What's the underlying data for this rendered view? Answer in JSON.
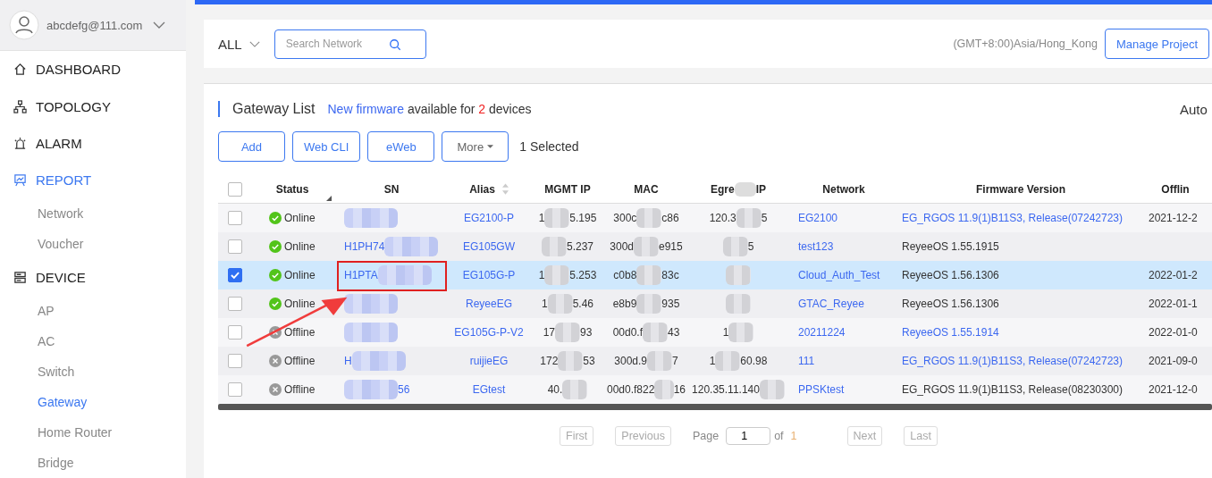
{
  "sidebar": {
    "user": "abcdefg@111.com",
    "items": [
      {
        "label": "DASHBOARD",
        "selected": false
      },
      {
        "label": "TOPOLOGY",
        "selected": false
      },
      {
        "label": "ALARM",
        "selected": false
      },
      {
        "label": "REPORT",
        "selected": true,
        "children": [
          {
            "label": "Network",
            "selected": false
          },
          {
            "label": "Voucher",
            "selected": false
          }
        ]
      },
      {
        "label": "DEVICE",
        "selected": false,
        "children": [
          {
            "label": "AP",
            "selected": false
          },
          {
            "label": "AC",
            "selected": false
          },
          {
            "label": "Switch",
            "selected": false
          },
          {
            "label": "Gateway",
            "selected": true
          },
          {
            "label": "Home Router",
            "selected": false
          },
          {
            "label": "Bridge",
            "selected": false
          }
        ]
      }
    ]
  },
  "header": {
    "scope": "ALL",
    "search": {
      "placeholder": "Search Network"
    },
    "timezone": "(GMT+8:00)Asia/Hong_Kong",
    "manage_button": "Manage Project"
  },
  "list": {
    "title": "Gateway List",
    "notice": {
      "link": "New firmware",
      "text1": "available for",
      "count": "2",
      "text2": "devices"
    },
    "auto": "Auto",
    "buttons": [
      "Add",
      "Web CLI",
      "eWeb"
    ],
    "more": "More",
    "selected_count": "1 Selected",
    "select_all": {
      "checked": false
    },
    "columns": [
      {
        "label": "Status"
      },
      {
        "label": "SN"
      },
      {
        "label": "Alias"
      },
      {
        "label": "MGMT IP"
      },
      {
        "label": "MAC"
      },
      {
        "pre": "Egre",
        "post": "IP"
      },
      {
        "label": "Network"
      },
      {
        "label": "Firmware Version"
      },
      {
        "label": "Offlin"
      }
    ],
    "rows": [
      {
        "checked": false,
        "kind": "online",
        "status": "Online",
        "sn": {},
        "alias": "EG2100-P",
        "mgmt": {
          "pre": "1",
          "post": "5.195"
        },
        "mac": {
          "pre": "300c",
          "post": "c86"
        },
        "egress": {
          "pre": "120.3",
          "post": "5"
        },
        "network": "EG2100",
        "firmware": {
          "text": "EG_RGOS 11.9(1)B11S3, Release(07242723)",
          "link": true
        },
        "offline": "2021-12-2"
      },
      {
        "checked": false,
        "kind": "online",
        "status": "Online",
        "sn": {
          "pre": "H1PH74"
        },
        "alias": "EG105GW",
        "mgmt": {
          "post": "5.237"
        },
        "mac": {
          "pre": "300d",
          "post": "e915"
        },
        "egress": {
          "post": "5"
        },
        "network": "test123",
        "firmware": {
          "text": "ReyeeOS 1.55.1915",
          "link": false
        }
      },
      {
        "checked": true,
        "kind": "online",
        "status": "Online",
        "sn": {
          "pre": "H1PTA"
        },
        "alias": "EG105G-P",
        "mgmt": {
          "pre": "1",
          "post": "5.253"
        },
        "mac": {
          "pre": "c0b8",
          "post": "83c"
        },
        "egress": {},
        "network": "Cloud_Auth_Test",
        "firmware": {
          "text": "ReyeeOS 1.56.1306",
          "link": false
        },
        "offline": "2022-01-2"
      },
      {
        "checked": false,
        "kind": "online",
        "status": "Online",
        "sn": {},
        "alias": "ReyeeEG",
        "mgmt": {
          "pre": "1",
          "post": "5.46"
        },
        "mac": {
          "pre": "e8b9",
          "post": "935"
        },
        "egress": {},
        "network": "GTAC_Reyee",
        "firmware": {
          "text": "ReyeeOS 1.56.1306",
          "link": false
        },
        "offline": "2022-01-1"
      },
      {
        "checked": false,
        "kind": "offline",
        "status": "Offline",
        "sn": {},
        "alias": "EG105G-P-V2",
        "mgmt": {
          "pre": "17",
          "post": "93"
        },
        "mac": {
          "pre": "00d0.f",
          "post": "43"
        },
        "egress": {
          "pre": "1"
        },
        "network": "20211224",
        "firmware": {
          "text": "ReyeeOS 1.55.1914",
          "link": true
        },
        "offline": "2022-01-0"
      },
      {
        "checked": false,
        "kind": "offline",
        "status": "Offline",
        "sn": {
          "pre": "H"
        },
        "alias": "ruijieEG",
        "mgmt": {
          "pre": "172",
          "post": "53"
        },
        "mac": {
          "pre": "300d.9",
          "post": "7"
        },
        "egress": {
          "pre": "1",
          "post": "60.98"
        },
        "network": "111",
        "firmware": {
          "text": "EG_RGOS 11.9(1)B11S3, Release(07242723)",
          "link": true
        },
        "offline": "2021-09-0"
      },
      {
        "checked": false,
        "kind": "offline",
        "status": "Offline",
        "sn": {
          "post": "56"
        },
        "alias": "EGtest",
        "mgmt": {
          "pre": "40."
        },
        "mac": {
          "pre": "00d0.f822",
          "post": "16"
        },
        "egress": {
          "pre": "120.35.11.140"
        },
        "network": "PPSKtest",
        "firmware": {
          "text": "EG_RGOS 11.9(1)B11S3, Release(08230300)",
          "link": false
        },
        "offline": "2021-12-0"
      }
    ]
  },
  "pagination": {
    "first": {
      "label": "First",
      "disabled": true
    },
    "previous": {
      "label": "Previous",
      "disabled": true
    },
    "page_label": "Page",
    "page": "1",
    "of": "of",
    "total": "1",
    "next": {
      "label": "Next",
      "disabled": true
    },
    "last": {
      "label": "Last",
      "disabled": true
    }
  }
}
